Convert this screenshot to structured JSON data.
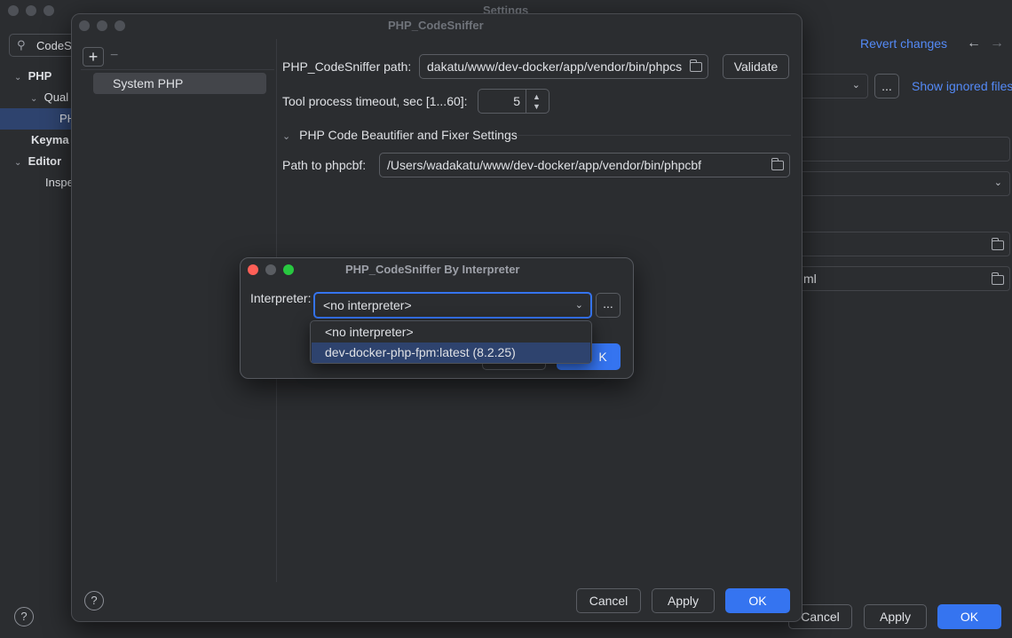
{
  "settings_window": {
    "title": "Settings",
    "search_value": "CodeS",
    "tree": [
      {
        "label": "PHP",
        "bold": true
      },
      {
        "label": "Qual"
      },
      {
        "label": "PH"
      },
      {
        "label": "Keyma",
        "bold": true
      },
      {
        "label": "Editor",
        "bold": true
      },
      {
        "label": "Inspe"
      }
    ],
    "revert_changes": "Revert changes",
    "show_ignored_files": "Show ignored files",
    "more_button": "...",
    "path_fragment": "ml",
    "cancel_label": "Cancel",
    "apply_label": "Apply",
    "ok_label": "OK",
    "help": "?"
  },
  "codesniffer_window": {
    "title": "PHP_CodeSniffer",
    "add_symbol": "+",
    "remove_symbol": "−",
    "configurations": [
      "System PHP"
    ],
    "path_label": "PHP_CodeSniffer path:",
    "path_value": "dakatu/www/dev-docker/app/vendor/bin/phpcs",
    "validate_label": "Validate",
    "timeout_label": "Tool process timeout, sec [1...60]:",
    "timeout_value": "5",
    "section_title": "PHP Code Beautifier and Fixer Settings",
    "phpcbf_label": "Path to phpcbf:",
    "phpcbf_value": "/Users/wadakatu/www/dev-docker/app/vendor/bin/phpcbf",
    "help": "?",
    "cancel_label": "Cancel",
    "apply_label": "Apply",
    "ok_label": "OK"
  },
  "interpreter_dialog": {
    "title": "PHP_CodeSniffer By Interpreter",
    "interpreter_label": "Interpreter:",
    "selected_value": "<no interpreter>",
    "more_label": "...",
    "ok_label": "K",
    "options": [
      "<no interpreter>",
      "dev-docker-php-fpm:latest (8.2.25)"
    ],
    "highlighted_option_index": 1
  },
  "colors": {
    "accent": "#3574f0",
    "link": "#548af7",
    "close": "#ff5f57",
    "minimize": "#5a5d62",
    "maximize": "#28c840",
    "highlight": "#2e436e"
  }
}
